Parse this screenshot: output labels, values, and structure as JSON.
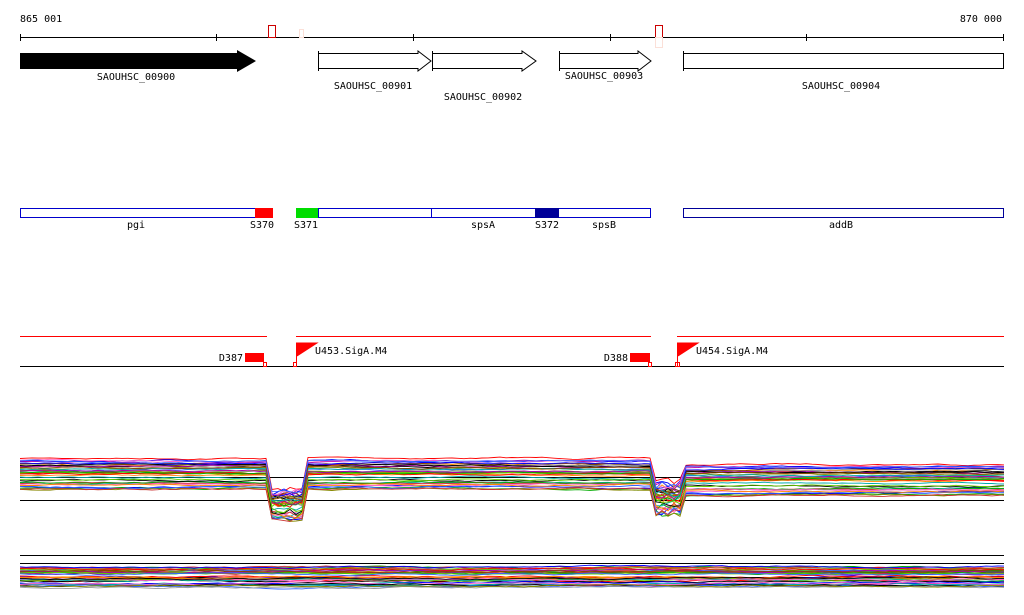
{
  "ruler": {
    "start_label": "865 001",
    "end_label": "870 000"
  },
  "genes": [
    {
      "id": "SAOUHSC_00900",
      "filled": true
    },
    {
      "id": "SAOUHSC_00901",
      "filled": false
    },
    {
      "id": "SAOUHSC_00902",
      "filled": false
    },
    {
      "id": "SAOUHSC_00903",
      "filled": false
    },
    {
      "id": "SAOUHSC_00904",
      "filled": false
    }
  ],
  "annotations": {
    "pgi": "pgi",
    "s370": "S370",
    "s371": "S371",
    "spsA": "spsA",
    "s372": "S372",
    "spsB": "spsB",
    "addB": "addB"
  },
  "features": {
    "d387": "D387",
    "u453": "U453.SigA.M4",
    "d388": "D388",
    "u454": "U454.SigA.M4"
  },
  "colors": {
    "red": "#ff0000",
    "green": "#00dd00",
    "navy": "#000099",
    "blue": "#0000cc",
    "darkred": "#cc0000"
  }
}
